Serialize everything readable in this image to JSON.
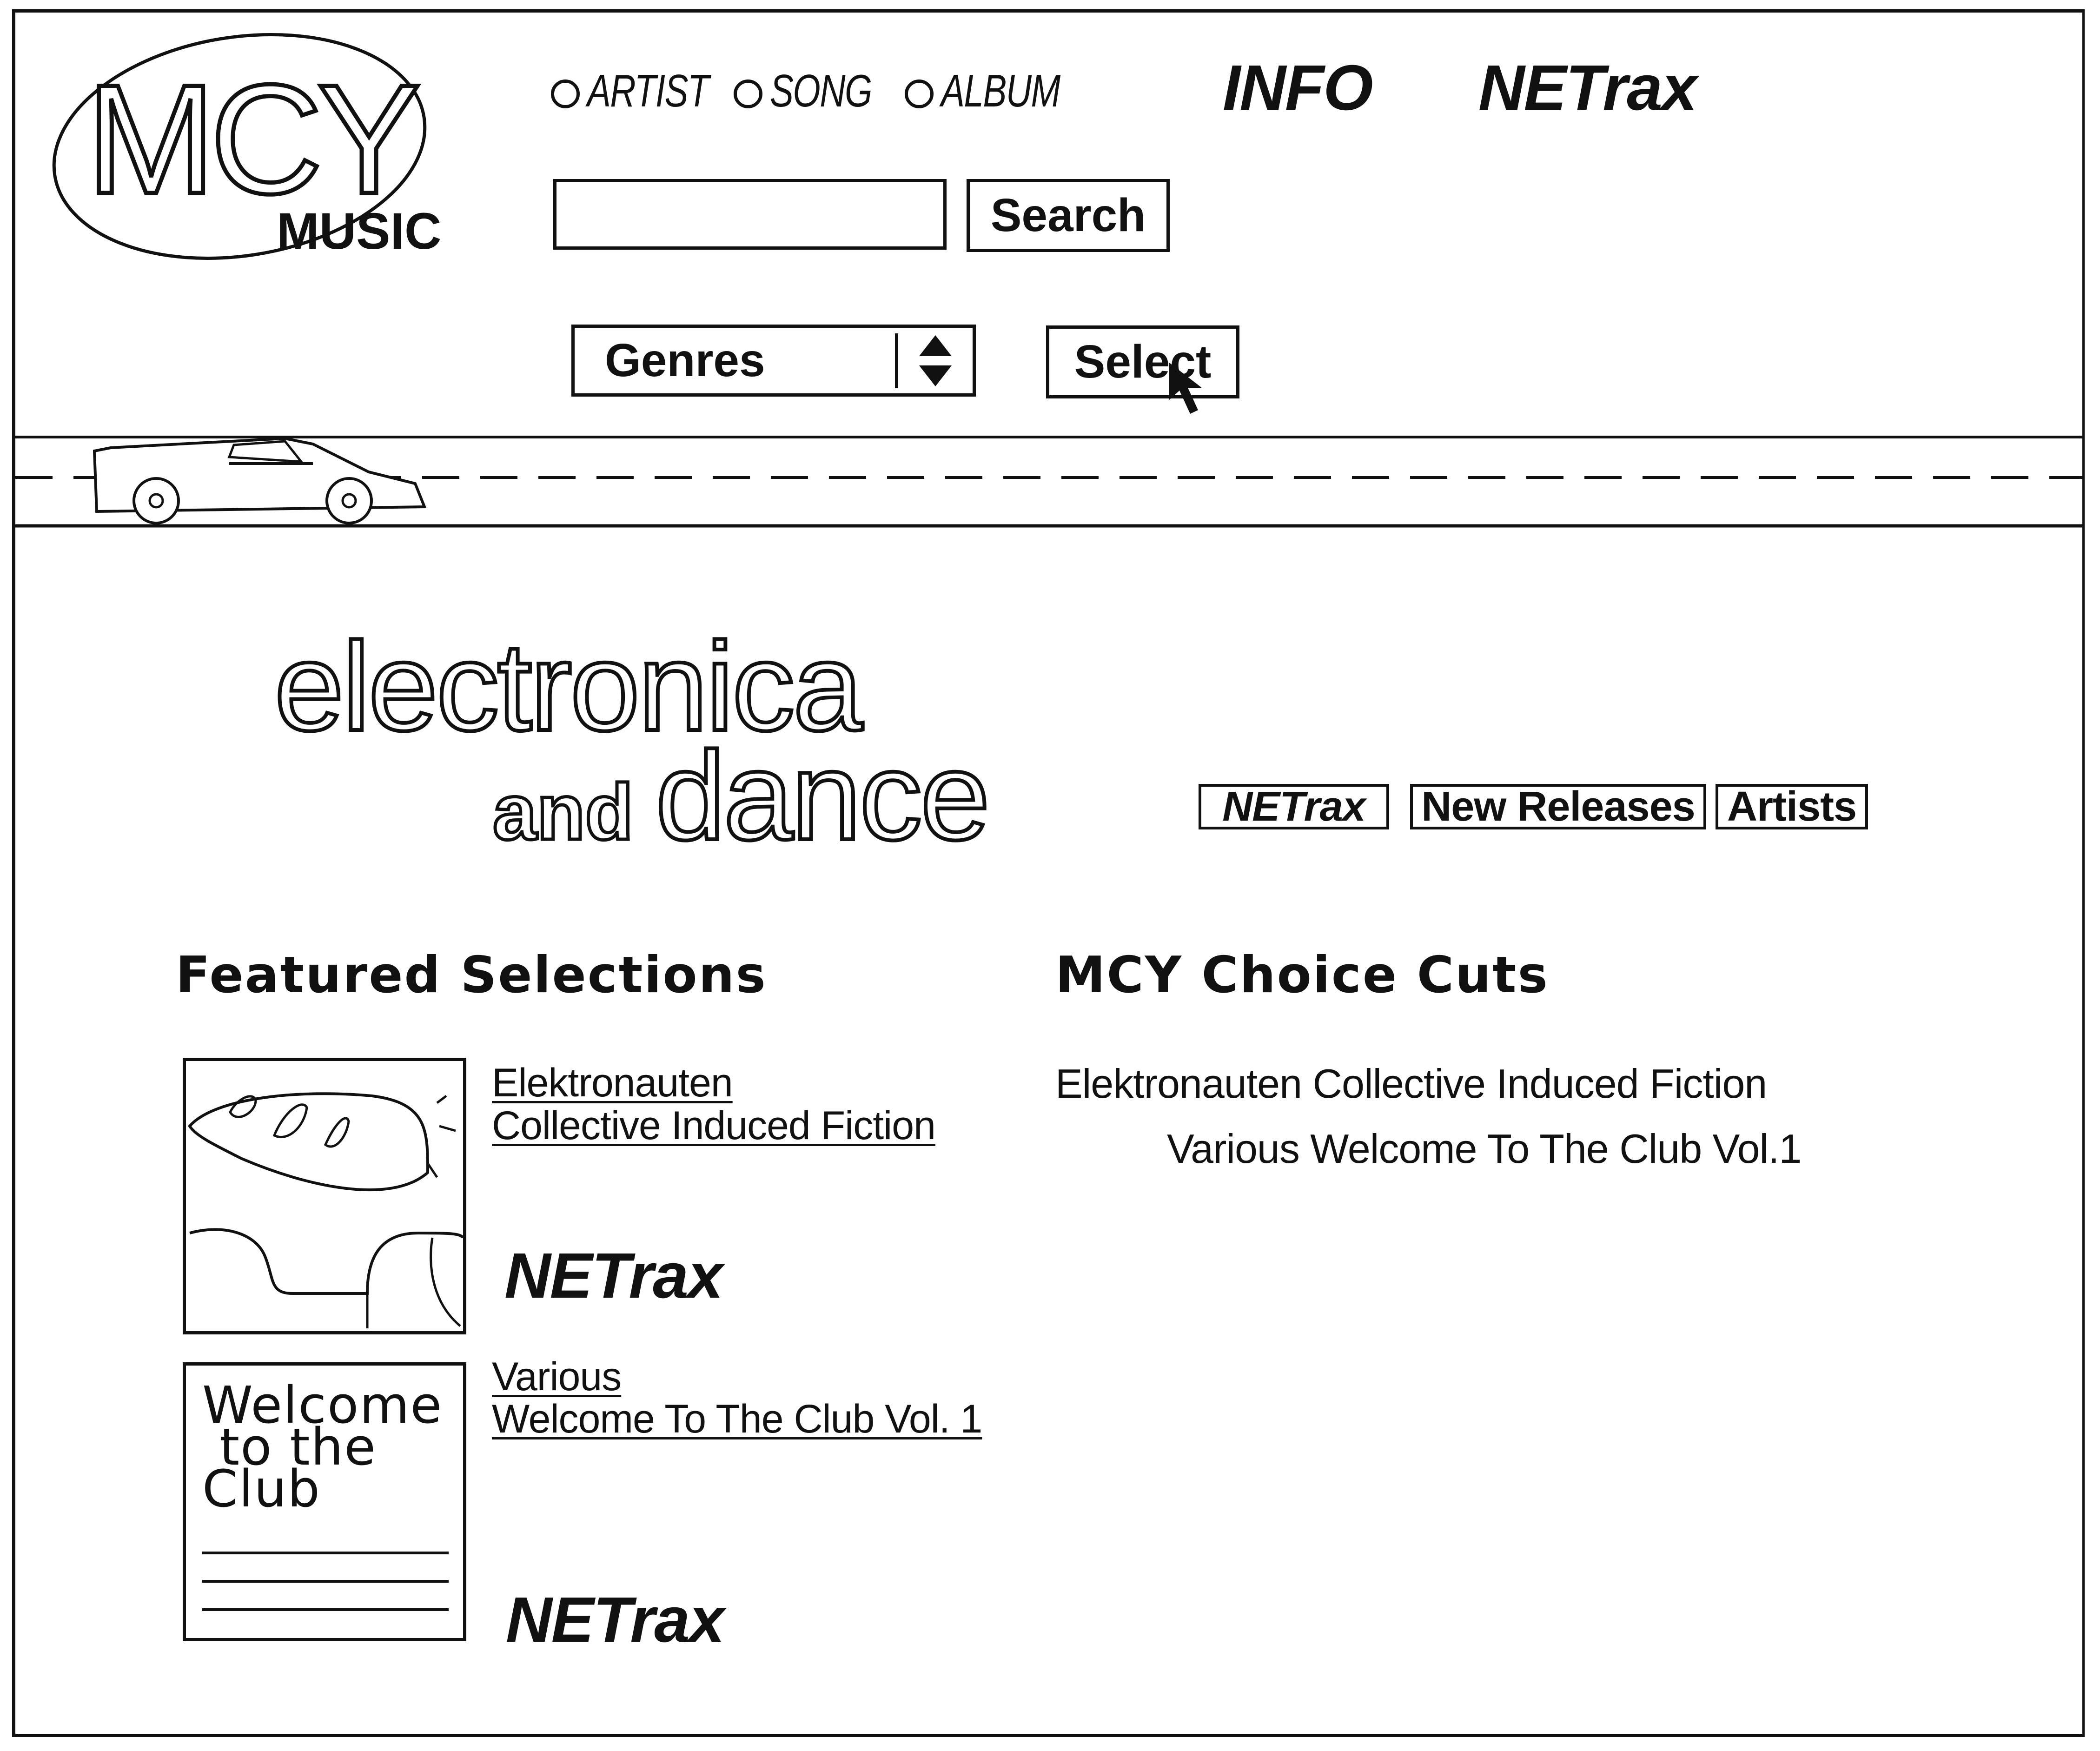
{
  "logo": {
    "main": "MCY",
    "sub": "MUSIC"
  },
  "search_types": [
    {
      "label": "ARTIST",
      "selected": false
    },
    {
      "label": "SONG",
      "selected": false
    },
    {
      "label": "ALBUM",
      "selected": false
    }
  ],
  "top_nav": {
    "info": "INFO",
    "netrax": "NETrax"
  },
  "search": {
    "value": "",
    "placeholder": "",
    "button": "Search"
  },
  "genres": {
    "selected": "Genres",
    "button": "Select"
  },
  "page_title": {
    "line1": "electronica",
    "line2a": "and",
    "line2b": "dance"
  },
  "tabs": [
    "NETrax",
    "New Releases",
    "Artists"
  ],
  "featured": {
    "heading": "Featured Selections",
    "items": [
      {
        "artist": "Elektronauten",
        "album": "Collective Induced Fiction",
        "netrax": "NETrax"
      },
      {
        "artist": "Various",
        "album": "Welcome To The Club Vol. 1",
        "netrax": "NETrax",
        "cover_text": "Welcome\n to the\nClub"
      }
    ]
  },
  "choice_cuts": {
    "heading": "MCY Choice Cuts",
    "items": [
      "Elektronauten Collective Induced Fiction",
      "Various Welcome To The Club Vol.1"
    ]
  }
}
